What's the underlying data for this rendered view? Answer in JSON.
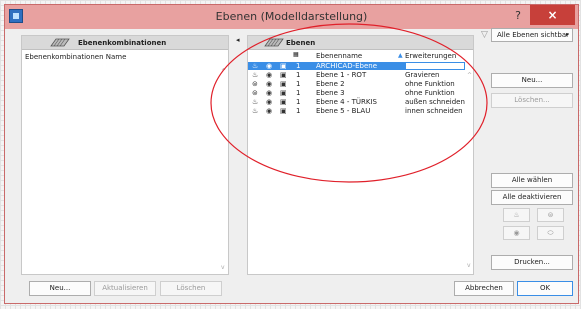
{
  "window": {
    "title": "Ebenen (Modelldarstellung)",
    "help": "?",
    "close": "×"
  },
  "left_panel": {
    "header": "Ebenenkombinationen",
    "column_name": "Ebenenkombinationen Name",
    "buttons": {
      "new": "Neu...",
      "refresh": "Aktualisieren",
      "delete": "Löschen"
    }
  },
  "right_panel": {
    "header": "Ebenen",
    "columns": {
      "name": "Ebenenname",
      "ext": "Erweiterungen"
    },
    "layers": [
      {
        "num": "1",
        "name": "ARCHICAD-Ebene",
        "ext": "",
        "selected": true
      },
      {
        "num": "1",
        "name": "Ebene 1 - ROT",
        "ext": "Gravieren"
      },
      {
        "num": "1",
        "name": "Ebene 2",
        "ext": "ohne Funktion"
      },
      {
        "num": "1",
        "name": "Ebene 3",
        "ext": "ohne Funktion"
      },
      {
        "num": "1",
        "name": "Ebene 4 - TÜRKIS",
        "ext": "außen schneiden"
      },
      {
        "num": "1",
        "name": "Ebene 5 - BLAU",
        "ext": "innen schneiden"
      }
    ]
  },
  "side_buttons": {
    "filter": "Alle Ebenen sichtbar",
    "new": "Neu...",
    "delete": "Löschen...",
    "select_all": "Alle wählen",
    "deactivate_all": "Alle deaktivieren",
    "print": "Drucken..."
  },
  "footer": {
    "cancel": "Abbrechen",
    "ok": "OK"
  },
  "colors": {
    "title_bar": "#e8a1a0",
    "close": "#c7403a",
    "annotation": "#e0202a",
    "selection": "#3a8ee6"
  }
}
